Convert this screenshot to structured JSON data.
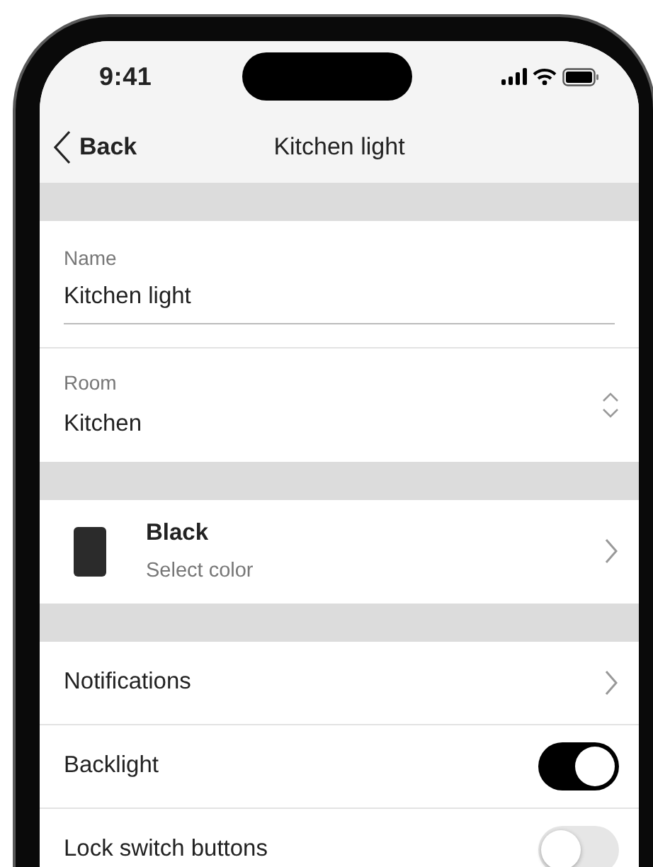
{
  "status_bar": {
    "time": "9:41"
  },
  "nav": {
    "back": "Back",
    "title": "Kitchen light"
  },
  "fields": [
    {
      "kind": "text",
      "label": "Name",
      "value": "Kitchen light"
    },
    {
      "kind": "select",
      "label": "Room",
      "value": "Kitchen"
    }
  ],
  "color_option": {
    "title": "Black",
    "subtitle": "Select color"
  },
  "settings": [
    {
      "kind": "link",
      "label": "Notifications"
    },
    {
      "kind": "toggle",
      "label": "Backlight",
      "on": true
    },
    {
      "kind": "toggle",
      "label": "Lock switch buttons",
      "on": false
    }
  ]
}
